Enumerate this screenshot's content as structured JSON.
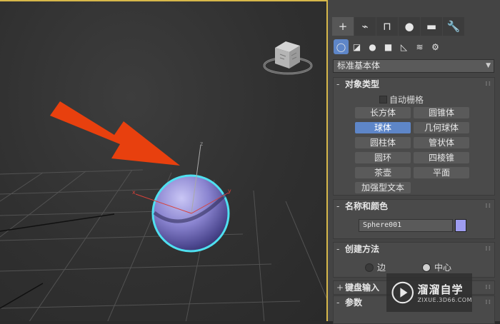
{
  "viewport": {
    "axis_labels": {
      "x": "x",
      "y": "y",
      "z": "z"
    },
    "sphere_color": "#8c86d2",
    "selection_color": "#4fe0f0",
    "arrow_color": "#e8400e",
    "viewcube_icon": "viewcube-icon"
  },
  "command_panel": {
    "tabs": [
      {
        "icon": "create-icon",
        "glyph": "+"
      },
      {
        "icon": "modify-icon",
        "glyph": "⌁"
      },
      {
        "icon": "hierarchy-icon",
        "glyph": "⊓"
      },
      {
        "icon": "motion-icon",
        "glyph": "●"
      },
      {
        "icon": "display-icon",
        "glyph": "▬"
      },
      {
        "icon": "utilities-icon",
        "glyph": "🔧"
      }
    ],
    "categories": [
      {
        "icon": "geometry-icon",
        "glyph": "◯"
      },
      {
        "icon": "shapes-icon",
        "glyph": "◪"
      },
      {
        "icon": "lights-icon",
        "glyph": "●"
      },
      {
        "icon": "cameras-icon",
        "glyph": "■"
      },
      {
        "icon": "helpers-icon",
        "glyph": "◺"
      },
      {
        "icon": "spacewarps-icon",
        "glyph": "≋"
      },
      {
        "icon": "systems-icon",
        "glyph": "⚙"
      }
    ],
    "dropdown_value": "标准基本体",
    "object_type": {
      "title": "对象类型",
      "sign": "-",
      "autogrid_label": "自动栅格",
      "buttons": [
        {
          "label": "长方体",
          "active": false
        },
        {
          "label": "圆锥体",
          "active": false
        },
        {
          "label": "球体",
          "active": true
        },
        {
          "label": "几何球体",
          "active": false
        },
        {
          "label": "圆柱体",
          "active": false
        },
        {
          "label": "管状体",
          "active": false
        },
        {
          "label": "圆环",
          "active": false
        },
        {
          "label": "四棱锥",
          "active": false
        },
        {
          "label": "茶壶",
          "active": false
        },
        {
          "label": "平面",
          "active": false
        },
        {
          "label": "加强型文本",
          "active": false
        }
      ]
    },
    "name_color": {
      "title": "名称和颜色",
      "sign": "-",
      "name_value": "Sphere001",
      "swatch_color": "#9e9cf0"
    },
    "creation_method": {
      "title": "创建方法",
      "sign": "-",
      "option_edge": "边",
      "option_center": "中心"
    },
    "keyboard_entry": {
      "title": "键盘输入",
      "sign": "+"
    },
    "parameters": {
      "title": "参数",
      "sign": "-"
    }
  },
  "watermark": {
    "title": "溜溜自学",
    "subtitle": "ZIXUE.3D66.COM"
  }
}
